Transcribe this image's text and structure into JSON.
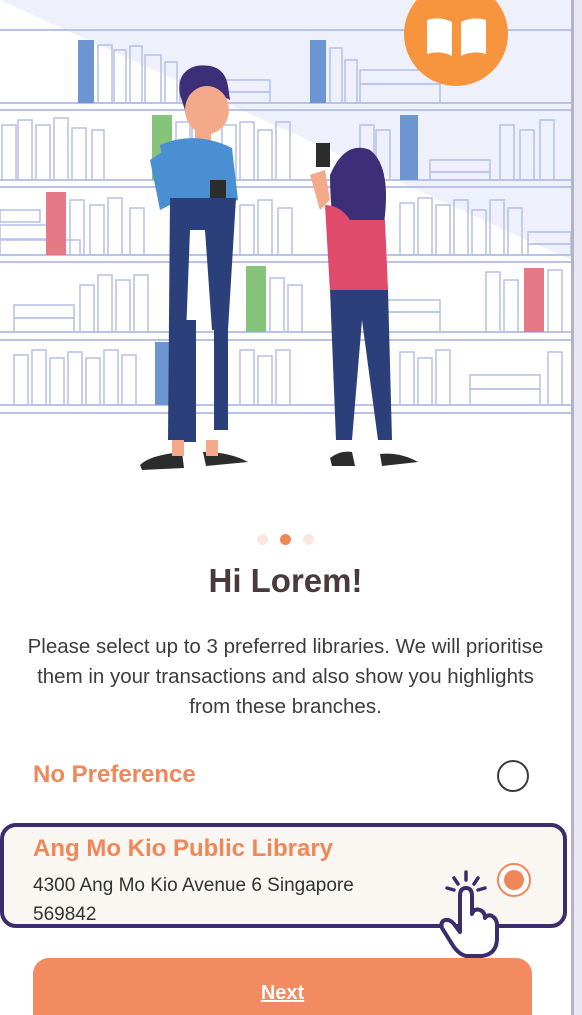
{
  "onboarding": {
    "title": "Hi Lorem!",
    "description": "Please select up to 3 preferred libraries. We will prioritise them in your transactions and also show you highlights from these branches.",
    "pagination": {
      "total": 3,
      "active": 2
    }
  },
  "options": {
    "no_preference": {
      "label": "No Preference",
      "selected": false
    },
    "library": {
      "name": "Ang Mo Kio Public Library",
      "address_line1": "4300 Ang Mo Kio Avenue 6   Singapore",
      "address_line2": "569842",
      "selected": true
    }
  },
  "actions": {
    "next_label": "Next"
  },
  "colors": {
    "accent": "#f08758",
    "heading": "#4a3a3c",
    "highlight_border": "#3a2d6c",
    "shelf_line": "#b9c3e8"
  },
  "icons": {
    "badge": "open-book-icon",
    "cursor": "hand-pointer-icon"
  }
}
